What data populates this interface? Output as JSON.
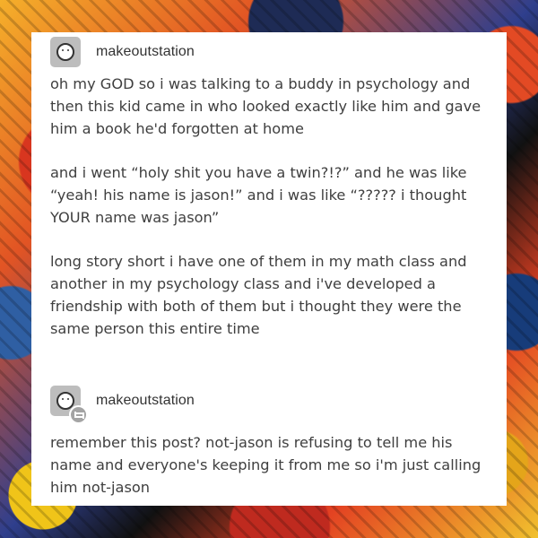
{
  "background": {
    "description_colors": [
      "#f5b02a",
      "#e25424",
      "#2f3f8d",
      "#111111",
      "#f1c12e"
    ]
  },
  "posts": [
    {
      "username": "makeoutstation",
      "avatar_icon": "smiley-face-icon",
      "paragraphs": [
        "oh my GOD so i was talking to a buddy in psychology and then this kid came in who looked exactly like him and gave him a book he'd forgotten at home",
        "and i went “holy shit you have a twin?!?” and he was like “yeah! his name is jason!” and i was like “????? i thought YOUR name was jason”",
        "long story short i have one of them in my math class and another in my psychology class and i've developed a friendship with both of them but i thought they were the same person this entire time"
      ]
    },
    {
      "username": "makeoutstation",
      "avatar_icon": "smiley-face-icon",
      "badge_icon": "reblog-icon",
      "paragraphs": [
        "remember this post? not-jason is refusing to tell me his name and everyone's keeping it from me so i'm just calling him not-jason"
      ]
    }
  ]
}
